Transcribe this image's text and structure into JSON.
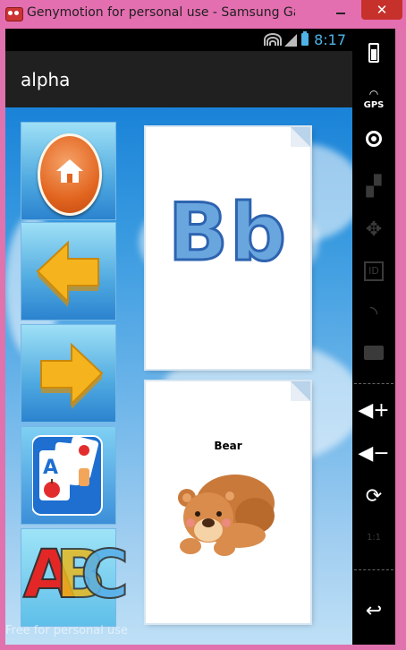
{
  "window": {
    "title": "Genymotion for personal use - Samsung Galax...",
    "close_glyph": "✕"
  },
  "status_bar": {
    "time": "8:17"
  },
  "action_bar": {
    "title": "alpha"
  },
  "nav_buttons": [
    {
      "name": "home-button",
      "icon": "home-icon"
    },
    {
      "name": "previous-button",
      "icon": "arrow-left-icon"
    },
    {
      "name": "next-button",
      "icon": "arrow-right-icon"
    },
    {
      "name": "cards-button",
      "icon": "flashcards-icon"
    },
    {
      "name": "abc-button",
      "icon": "abc-icon"
    }
  ],
  "letter_card": {
    "letters": "Bb",
    "color": "#6aa6de"
  },
  "picture_card": {
    "word": "Bear",
    "image": "bear-illustration"
  },
  "abc_button": {
    "letters": [
      "A",
      "B",
      "C"
    ]
  },
  "watermark": "Free for personal use",
  "toolbar": {
    "items": [
      {
        "icon": "battery-icon",
        "enabled": true
      },
      {
        "icon": "gps-icon",
        "label": "GPS",
        "enabled": true
      },
      {
        "icon": "webcam-icon",
        "enabled": true
      },
      {
        "icon": "video-clapper-icon",
        "enabled": false
      },
      {
        "icon": "dpad-icon",
        "enabled": false
      },
      {
        "icon": "id-icon",
        "label": "ID",
        "enabled": false
      },
      {
        "icon": "rss-icon",
        "enabled": false
      },
      {
        "icon": "sms-icon",
        "enabled": false
      },
      {
        "icon": "volume-up-icon",
        "enabled": true
      },
      {
        "icon": "volume-down-icon",
        "enabled": true
      },
      {
        "icon": "rotate-icon",
        "enabled": true
      },
      {
        "icon": "pixel-perfect-icon",
        "label": "1:1",
        "enabled": false
      },
      {
        "icon": "back-icon",
        "enabled": true
      }
    ]
  }
}
